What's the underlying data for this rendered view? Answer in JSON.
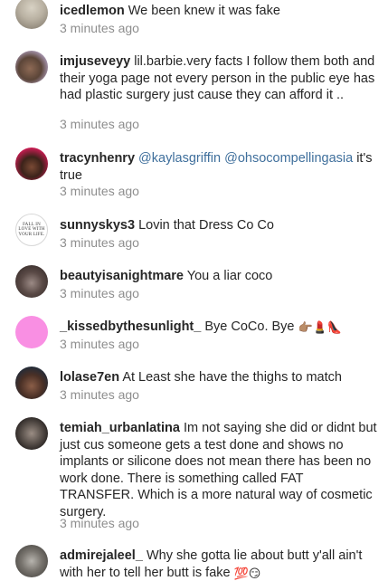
{
  "comments": [
    {
      "username": "icedlemon",
      "parts": [
        {
          "type": "text",
          "value": "We been knew it was fake"
        }
      ],
      "time": "3 minutes ago",
      "avatar_icon": "profile-photo"
    },
    {
      "username": "imjuseveyy",
      "parts": [
        {
          "type": "text",
          "value": "lil.barbie.very facts I follow them both and their yoga page not every person in the public eye has had plastic surgery just cause they can afford it .."
        }
      ],
      "time": "3 minutes ago",
      "avatar_icon": "profile-photo"
    },
    {
      "username": "tracynhenry",
      "parts": [
        {
          "type": "mention",
          "value": "@kaylasgriffin"
        },
        {
          "type": "mention",
          "value": "@ohsocompellingasia"
        },
        {
          "type": "text",
          "value": "it's true"
        }
      ],
      "time": "3 minutes ago",
      "avatar_icon": "profile-photo"
    },
    {
      "username": "sunnyskys3",
      "parts": [
        {
          "type": "text",
          "value": "Lovin that Dress Co Co"
        }
      ],
      "time": "3 minutes ago",
      "avatar_icon": "text-logo",
      "avatar_text": "FALL IN LOVE WITH YOUR LIFE."
    },
    {
      "username": "beautyisanightmare",
      "parts": [
        {
          "type": "text",
          "value": "You a liar coco"
        }
      ],
      "time": "3 minutes ago",
      "avatar_icon": "profile-photo"
    },
    {
      "username": "_kissedbythesunlight_",
      "parts": [
        {
          "type": "text",
          "value": "Bye CoCo. Bye"
        },
        {
          "type": "emoji",
          "value": "👉🏽💄👠"
        }
      ],
      "time": "3 minutes ago",
      "avatar_icon": "pink-circle"
    },
    {
      "username": "lolase7en",
      "parts": [
        {
          "type": "text",
          "value": "At Least she have the thighs to match"
        }
      ],
      "time": "3 minutes ago",
      "avatar_icon": "profile-photo"
    },
    {
      "username": "temiah_urbanlatina",
      "parts": [
        {
          "type": "text",
          "value": "Im not saying she did or didnt but just cus someone gets a test done and shows no implants or silicone does not mean there has been no work done. There is something called FAT TRANSFER. Which is a more natural way of cosmetic surgery."
        }
      ],
      "time": "3 minutes ago",
      "avatar_icon": "profile-photo"
    },
    {
      "username": "admirejaleel_",
      "parts": [
        {
          "type": "text",
          "value": "Why she gotta lie about butt y'all ain't with her to tell her butt is fake"
        },
        {
          "type": "emoji",
          "value": "💯😏"
        }
      ],
      "time": "",
      "avatar_icon": "profile-photo"
    }
  ],
  "colors": {
    "username": "#262626",
    "text": "#262626",
    "mention": "#3f6f9c",
    "timestamp": "#8e8e8e",
    "background": "#ffffff",
    "pink_avatar": "#f98fe3"
  }
}
